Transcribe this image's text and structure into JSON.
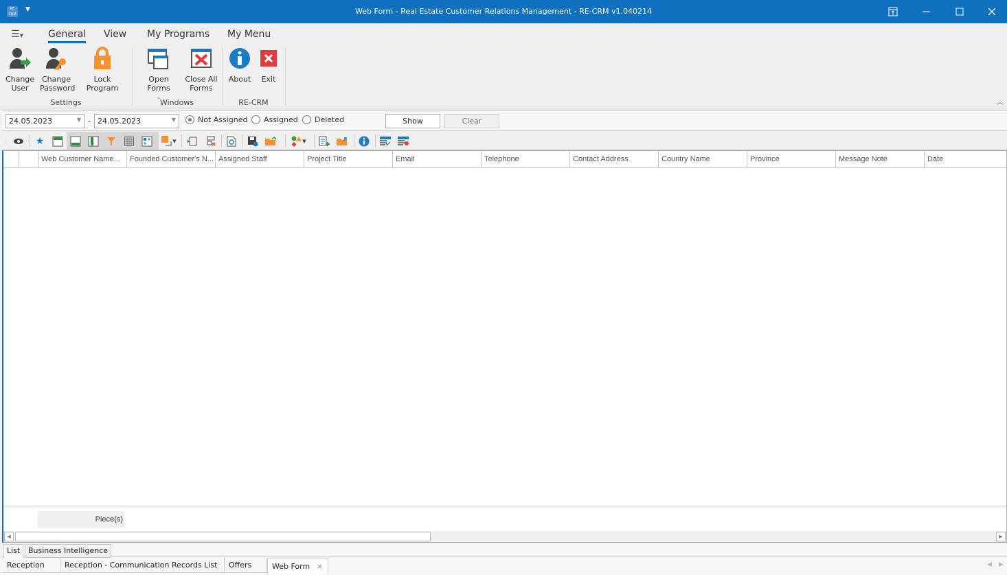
{
  "window": {
    "title": "Web Form - Real Estate Customer Relations Management - RE-CRM v1.040214",
    "app_icon": "RE CRM"
  },
  "ribbon": {
    "tabs": [
      "General",
      "View",
      "My Programs",
      "My Menu"
    ],
    "active_tab": "General",
    "groups": [
      {
        "label": "Settings",
        "buttons": [
          {
            "label": "Change User",
            "icon": "user-change-icon"
          },
          {
            "label": "Change Password",
            "icon": "user-key-icon"
          },
          {
            "label": "Lock Program",
            "icon": "lock-icon"
          }
        ]
      },
      {
        "label": "Windows",
        "buttons": [
          {
            "label": "Open Forms",
            "icon": "windows-icon"
          },
          {
            "label": "Close All Forms",
            "icon": "close-window-icon"
          }
        ]
      },
      {
        "label": "RE-CRM",
        "buttons": [
          {
            "label": "About",
            "icon": "info-icon"
          },
          {
            "label": "Exit",
            "icon": "exit-icon"
          }
        ]
      }
    ]
  },
  "filter": {
    "date_from": "24.05.2023",
    "date_to": "24.05.2023",
    "separator": "-",
    "radios": [
      {
        "label": "Not Assigned",
        "checked": true
      },
      {
        "label": "Assigned",
        "checked": false
      },
      {
        "label": "Deleted",
        "checked": false
      }
    ],
    "show_label": "Show",
    "clear_label": "Clear"
  },
  "grid": {
    "columns": [
      "Web Customer Name...",
      "Founded Customer's N...",
      "Assigned Staff",
      "Project Title",
      "Email",
      "Telephone",
      "Contact Address",
      "Country Name",
      "Province",
      "Message Note",
      "Date"
    ],
    "rows": [],
    "footer_summary": "Piece(s)"
  },
  "subtabs": [
    "List",
    "Business Intelligence"
  ],
  "doc_tabs": [
    "Reception",
    "Reception - Communication Records List",
    "Offers",
    "Web Form"
  ],
  "active_doc_tab": "Web Form",
  "colors": {
    "accent": "#1070c0"
  }
}
